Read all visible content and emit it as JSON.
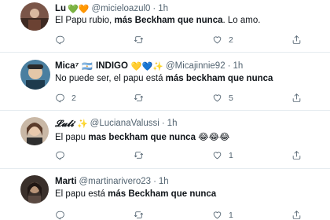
{
  "tweets": [
    {
      "name": "Lu",
      "handle": "@micieloazul0",
      "time": "1h",
      "emoji": "💚🧡",
      "text_a": "El Papu rubio, ",
      "text_b": "más Beckham que nunca",
      "text_c": ". Lo amo.",
      "reply_count": "",
      "retweet_count": "",
      "like_count": "2",
      "avatar_color": "#7a5548"
    },
    {
      "name": "Mica⁷",
      "handle": "@Micajinnie92",
      "time": "1h",
      "badge": "INDIGO",
      "emoji": "🇦🇷",
      "emoji2": "💛💙✨",
      "text_a": "No puede ser, el papu está ",
      "text_b": "más beckham que nunca",
      "text_c": "",
      "reply_count": "2",
      "retweet_count": "",
      "like_count": "5",
      "avatar_color": "#4a7fa0"
    },
    {
      "name": "𝓛𝓾𝓵𝓲",
      "handle": "@LucianaValussi",
      "time": "1h",
      "emoji": "✨",
      "text_a": "El papu ",
      "text_b": "mas beckham que nunca",
      "text_c": " 😂😂😂",
      "reply_count": "",
      "retweet_count": "",
      "like_count": "1",
      "avatar_color": "#8c6a4f"
    },
    {
      "name": "Marti",
      "handle": "@martinarivero23",
      "time": "1h",
      "text_a": "El papu está ",
      "text_b": "más Beckham que nunca",
      "text_c": "",
      "reply_count": "",
      "retweet_count": "",
      "like_count": "1",
      "avatar_color": "#5b4a42"
    }
  ],
  "icons": {
    "reply": "reply-icon",
    "retweet": "retweet-icon",
    "like": "heart-icon",
    "share": "share-icon"
  }
}
